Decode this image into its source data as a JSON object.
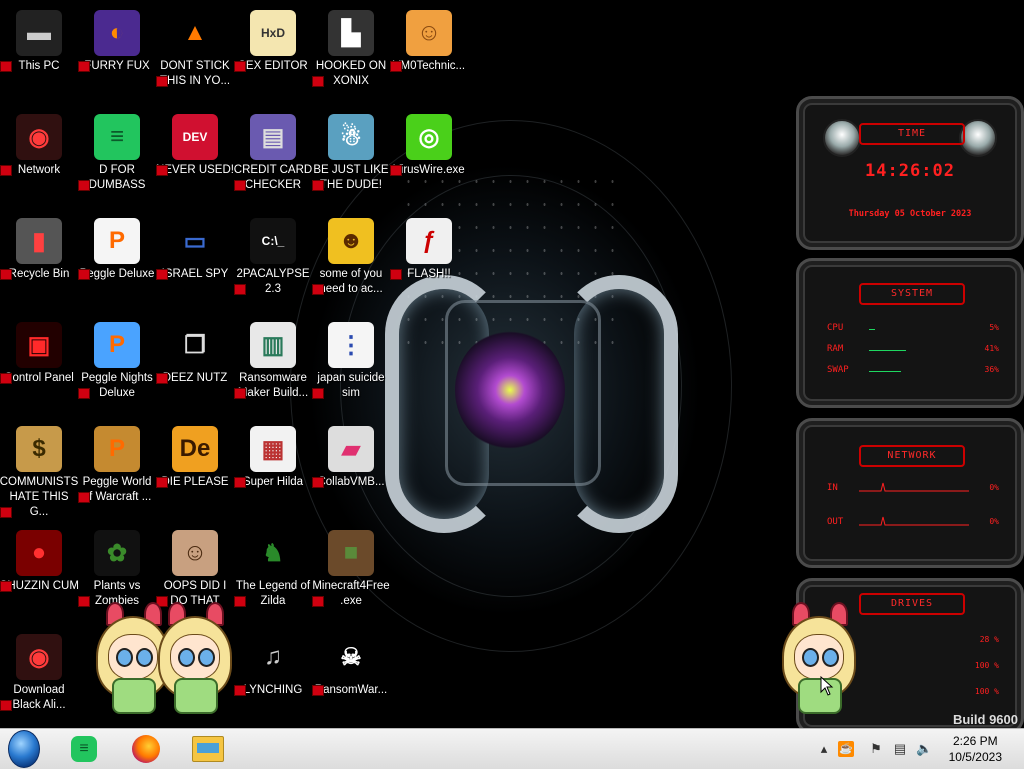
{
  "desktop_icons": [
    {
      "label": "This PC",
      "glyph": "▬",
      "color": "#ccc",
      "bg": "#222"
    },
    {
      "label": "Network",
      "glyph": "◉",
      "color": "#ff3b3b",
      "bg": "#301010"
    },
    {
      "label": "Recycle Bin",
      "glyph": "▮",
      "color": "#ff4040",
      "bg": "#555"
    },
    {
      "label": "Control Panel",
      "glyph": "▣",
      "color": "#ff2a2a",
      "bg": "#200"
    },
    {
      "label": "COMMUNISTS HATE THIS G...",
      "glyph": "$",
      "color": "#3a2a00",
      "bg": "#c79a4a"
    },
    {
      "label": "CHUZZIN CUM",
      "glyph": "●",
      "color": "#ff3030",
      "bg": "#7a0000"
    },
    {
      "label": "Download Black Ali...",
      "glyph": "◉",
      "color": "#ff3b3b",
      "bg": "#301010"
    },
    {
      "label": "FURRY FUX",
      "glyph": "◐",
      "color": "#ff8a00",
      "bg": "#4b2a90"
    },
    {
      "label": "D FOR DUMBASS",
      "glyph": "≡",
      "color": "#0b5a2a",
      "bg": "#22c55e"
    },
    {
      "label": "Peggle Deluxe",
      "glyph": "P",
      "color": "#ff6a00",
      "bg": "#f5f5f5"
    },
    {
      "label": "Peggle Nights Deluxe",
      "glyph": "P",
      "color": "#ff6a00",
      "bg": "#4aa3ff"
    },
    {
      "label": "Peggle World of Warcraft ...",
      "glyph": "P",
      "color": "#ff6a00",
      "bg": "#c58a30"
    },
    {
      "label": "Plants vs Zombies",
      "glyph": "✿",
      "color": "#3a8a2a",
      "bg": "#111"
    },
    {
      "label": "DONT STICK THIS IN YO...",
      "glyph": "▲",
      "color": "#ff7a00",
      "bg": "#000"
    },
    {
      "label": "NEVER USED!",
      "glyph": "DEV",
      "color": "#fff",
      "bg": "#d01030"
    },
    {
      "label": "ISRAEL SPY",
      "glyph": "▭",
      "color": "#3a6ad0",
      "bg": "#000"
    },
    {
      "label": "DEEZ NUTZ",
      "glyph": "❐",
      "color": "#ddd",
      "bg": "#000"
    },
    {
      "label": "DIE PLEASE",
      "glyph": "De",
      "color": "#3a1a00",
      "bg": "#f0a020"
    },
    {
      "label": "OOPS DID I DO THAT",
      "glyph": "☺",
      "color": "#4a2a10",
      "bg": "#c8a080"
    },
    {
      "label": "SEX EDITOR",
      "glyph": "HxD",
      "color": "#333",
      "bg": "#f4e6b0"
    },
    {
      "label": "CREDIT CARD CHECKER",
      "glyph": "▤",
      "color": "#ddd",
      "bg": "#6a5ab0"
    },
    {
      "label": "2PACALYPSE 2.3",
      "glyph": "C:\\_",
      "color": "#fff",
      "bg": "#111"
    },
    {
      "label": "Ransomware Maker Build...",
      "glyph": "▥",
      "color": "#2a7a5a",
      "bg": "#e8e8e8"
    },
    {
      "label": "Super Hilda",
      "glyph": "▦",
      "color": "#b33",
      "bg": "#f2f2f2"
    },
    {
      "label": "The Legend of Zilda",
      "glyph": "♞",
      "color": "#2a8a2a",
      "bg": "#000"
    },
    {
      "label": "LYNCHING",
      "glyph": "♫",
      "color": "#ccc",
      "bg": "#000"
    },
    {
      "label": "HOOKED ON XONIX",
      "glyph": "▙",
      "color": "#fff",
      "bg": "#333"
    },
    {
      "label": "BE JUST LIKE THE DUDE!",
      "glyph": "☃",
      "color": "#fff",
      "bg": "#5aa0c0"
    },
    {
      "label": "some of you need to ac...",
      "glyph": "☻",
      "color": "#5a2a00",
      "bg": "#f0c020"
    },
    {
      "label": "japan suicide sim",
      "glyph": "⋮",
      "color": "#2a4ab0",
      "bg": "#f5f5f5"
    },
    {
      "label": "CollabVMB...",
      "glyph": "▰",
      "color": "#e03070",
      "bg": "#ddd"
    },
    {
      "label": "Minecraft4Free .exe",
      "glyph": "■",
      "color": "#5a8a3a",
      "bg": "#6b4a2a"
    },
    {
      "label": "RansomWar...",
      "glyph": "☠",
      "color": "#fff",
      "bg": "#000"
    },
    {
      "label": "VM0Technic...",
      "glyph": "☺",
      "color": "#8a4a10",
      "bg": "#f0a040"
    },
    {
      "label": "VirusWire.exe",
      "glyph": "◎",
      "color": "#fff",
      "bg": "#4ad01a"
    },
    {
      "label": "FLASH!!",
      "glyph": "ƒ",
      "color": "#c00",
      "bg": "#f0f0f0"
    }
  ],
  "widgets": {
    "time": {
      "title": "TIME",
      "clock": "14:26:02",
      "date": "Thursday 05 October 2023"
    },
    "system": {
      "title": "SYSTEM",
      "rows": [
        {
          "label": "CPU",
          "value": "5%",
          "fill": 0.05
        },
        {
          "label": "RAM",
          "value": "41%",
          "fill": 0.41
        },
        {
          "label": "SWAP",
          "value": "36%",
          "fill": 0.36
        }
      ]
    },
    "network": {
      "title": "NETWORK",
      "rows": [
        {
          "label": "IN",
          "value": "0%"
        },
        {
          "label": "OUT",
          "value": "0%"
        }
      ]
    },
    "drives": {
      "title": "DRIVES",
      "rows": [
        {
          "value": "28 %"
        },
        {
          "value": "100 %"
        },
        {
          "value": "100 %"
        }
      ]
    }
  },
  "build_text": "Build 9600",
  "taskbar": {
    "start": "start-orb",
    "pinned": [
      "notes-icon",
      "firefox-icon",
      "file-explorer-icon"
    ],
    "tray_icons": [
      "chevron-up-icon",
      "java-icon",
      "flag-icon",
      "network-icon",
      "volume-icon"
    ],
    "time": "2:26 PM",
    "date": "10/5/2023"
  },
  "colors": {
    "widget_red": "#ff2020",
    "widget_green": "#1ed760",
    "taskbar_bg": "#e8e8e8"
  }
}
